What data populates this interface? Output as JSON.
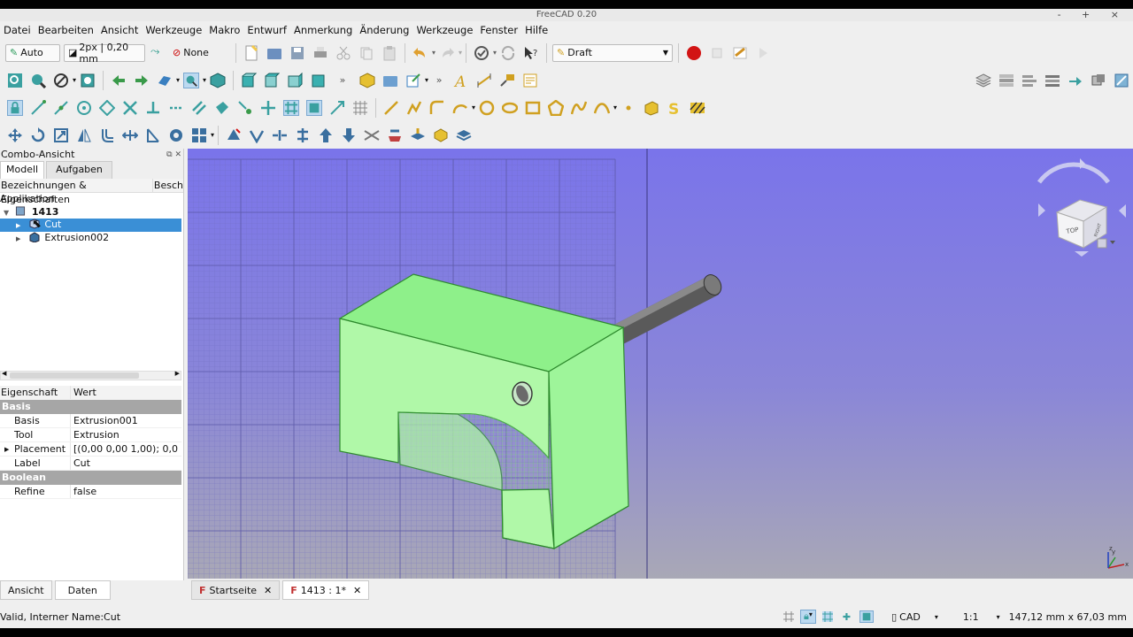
{
  "window": {
    "title": "FreeCAD 0.20",
    "controls": "- + ×"
  },
  "menu": [
    "Datei",
    "Bearbeiten",
    "Ansicht",
    "Werkzeuge",
    "Makro",
    "Entwurf",
    "Anmerkung",
    "Änderung",
    "Werkzeuge",
    "Fenster",
    "Hilfe"
  ],
  "toolbar1": {
    "auto_label": "Auto",
    "linewidth_label": "2px | 0,20 mm",
    "none_label": "None",
    "workbench": "Draft"
  },
  "combo": {
    "title": "Combo-Ansicht",
    "tabs": [
      "Modell",
      "Aufgaben"
    ],
    "tree_headers": [
      "Bezeichnungen & Eigenschaften",
      "Besch"
    ],
    "root_label": "Applikation",
    "doc_label": "1413",
    "items": [
      "Cut",
      "Extrusion002"
    ]
  },
  "properties": {
    "headers": [
      "Eigenschaft",
      "Wert"
    ],
    "group1": "Basis",
    "rows1": [
      {
        "k": "Basis",
        "v": "Extrusion001"
      },
      {
        "k": "Tool",
        "v": "Extrusion"
      },
      {
        "k": "Placement",
        "v": "[(0,00 0,00 1,00); 0,0..."
      },
      {
        "k": "Label",
        "v": "Cut"
      }
    ],
    "group2": "Boolean",
    "rows2": [
      {
        "k": "Refine",
        "v": "false"
      }
    ]
  },
  "bottom_tabs": [
    "Ansicht",
    "Daten"
  ],
  "doc_tabs": [
    "Startseite",
    "1413 : 1*"
  ],
  "navcube": {
    "top": "TOP",
    "right": "RIGHT"
  },
  "status": {
    "message": "Valid, Interner Name:Cut",
    "nav_style": "CAD",
    "scale": "1:1",
    "dimensions": "147,12 mm x 67,03 mm"
  },
  "colors": {
    "selection": "#3a8fd6",
    "solid": "#98f798",
    "bg_top": "#7a74ea"
  }
}
